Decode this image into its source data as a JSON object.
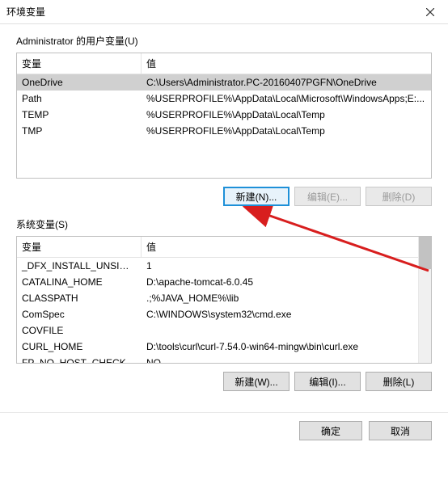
{
  "titlebar": {
    "title": "环境变量"
  },
  "user_section": {
    "label": "Administrator 的用户变量(U)",
    "header_var": "变量",
    "header_val": "值",
    "rows": [
      {
        "var": "OneDrive",
        "val": "C:\\Users\\Administrator.PC-20160407PGFN\\OneDrive"
      },
      {
        "var": "Path",
        "val": "%USERPROFILE%\\AppData\\Local\\Microsoft\\WindowsApps;E:..."
      },
      {
        "var": "TEMP",
        "val": "%USERPROFILE%\\AppData\\Local\\Temp"
      },
      {
        "var": "TMP",
        "val": "%USERPROFILE%\\AppData\\Local\\Temp"
      }
    ],
    "buttons": {
      "new": "新建(N)...",
      "edit": "编辑(E)...",
      "delete": "删除(D)"
    }
  },
  "system_section": {
    "label": "系统变量(S)",
    "header_var": "变量",
    "header_val": "值",
    "rows": [
      {
        "var": "_DFX_INSTALL_UNSIGNED...",
        "val": "1"
      },
      {
        "var": "CATALINA_HOME",
        "val": "D:\\apache-tomcat-6.0.45"
      },
      {
        "var": "CLASSPATH",
        "val": ".;%JAVA_HOME%\\lib"
      },
      {
        "var": "ComSpec",
        "val": "C:\\WINDOWS\\system32\\cmd.exe"
      },
      {
        "var": "COVFILE",
        "val": ""
      },
      {
        "var": "CURL_HOME",
        "val": "D:\\tools\\curl\\curl-7.54.0-win64-mingw\\bin\\curl.exe"
      },
      {
        "var": "FP_NO_HOST_CHECK",
        "val": "NO"
      }
    ],
    "buttons": {
      "new": "新建(W)...",
      "edit": "编辑(I)...",
      "delete": "删除(L)"
    }
  },
  "footer": {
    "ok": "确定",
    "cancel": "取消"
  }
}
